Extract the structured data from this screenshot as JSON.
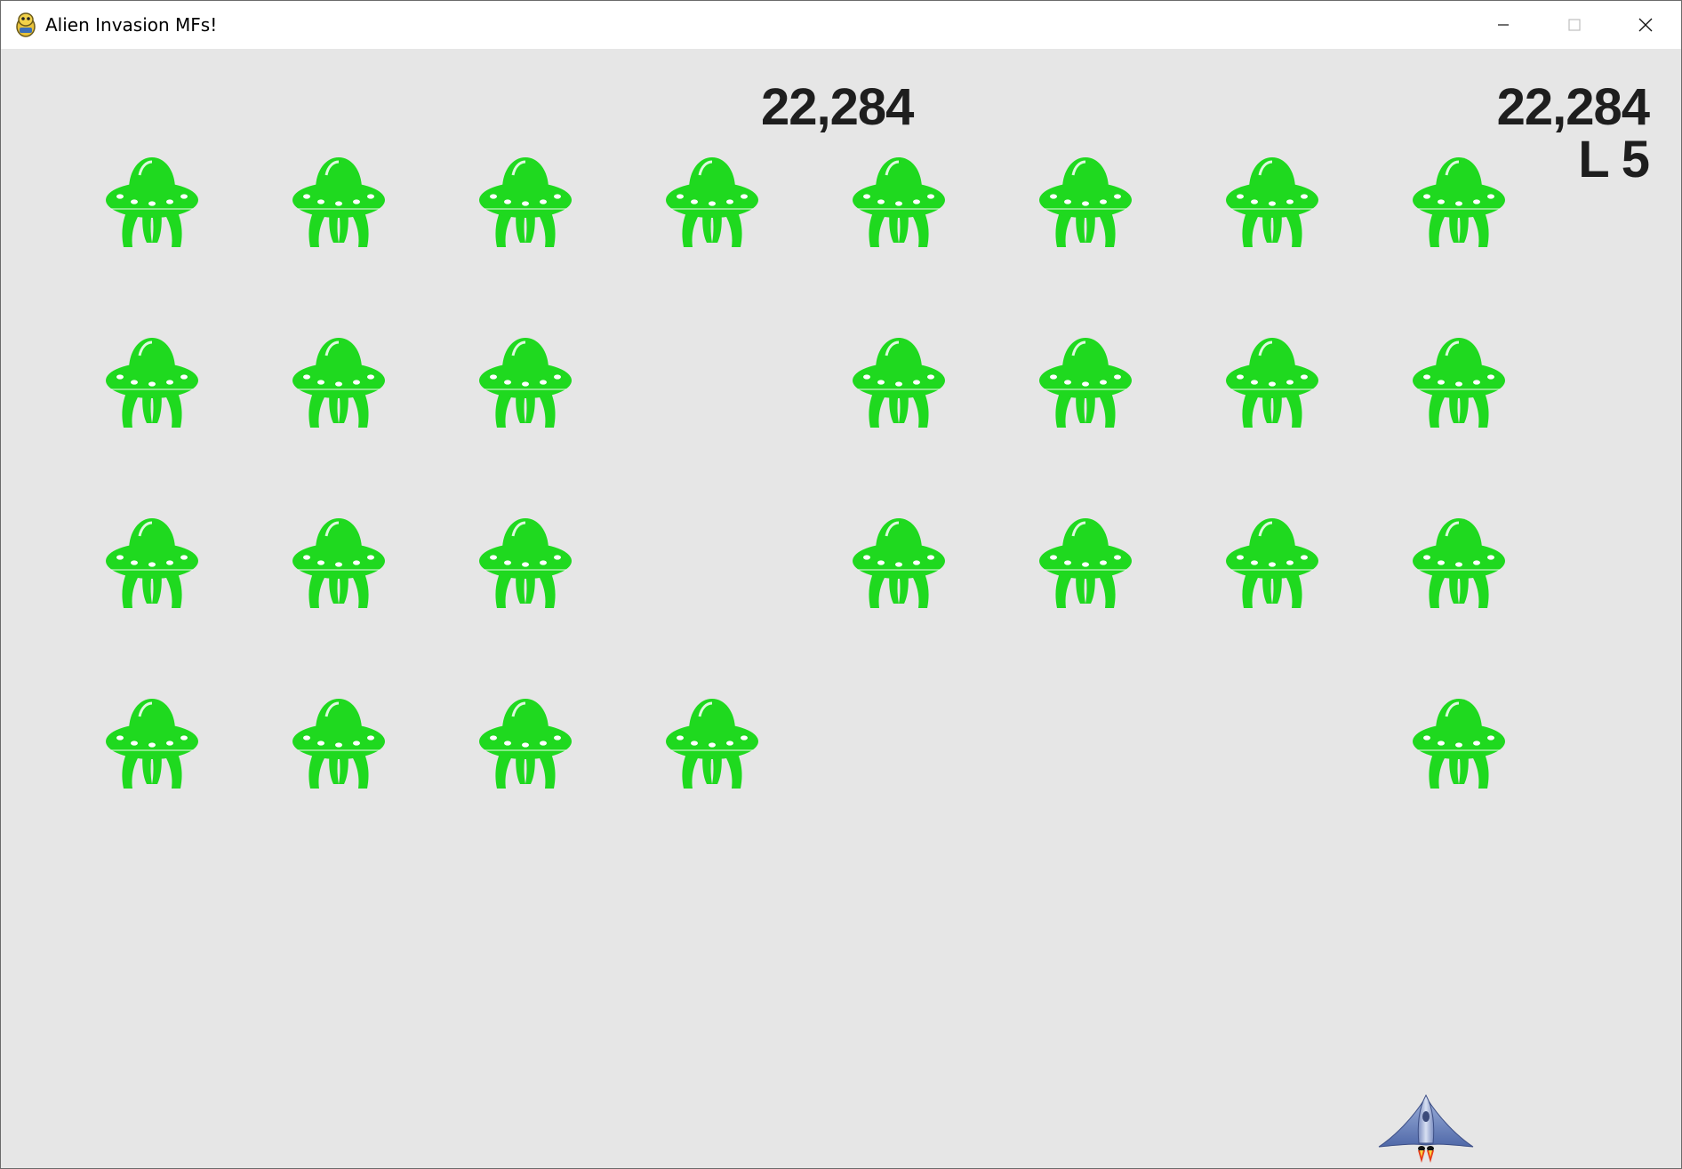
{
  "window": {
    "title": "Alien Invasion MFs!",
    "icon": "pygame-snake-icon"
  },
  "hud": {
    "score": "22,284",
    "high_score": "22,284",
    "level": "L 5"
  },
  "colors": {
    "background": "#e6e6e6",
    "alien": "#1fd91f",
    "hud_text": "#1e1e1e"
  },
  "alien_grid": {
    "rows": 4,
    "cols": 8,
    "present": [
      [
        true,
        true,
        true,
        true,
        true,
        true,
        true,
        true
      ],
      [
        true,
        true,
        true,
        false,
        true,
        true,
        true,
        true
      ],
      [
        true,
        true,
        true,
        false,
        true,
        true,
        true,
        true
      ],
      [
        true,
        true,
        true,
        true,
        false,
        false,
        false,
        true
      ]
    ]
  },
  "player": {
    "icon": "rocket-ship-icon"
  }
}
